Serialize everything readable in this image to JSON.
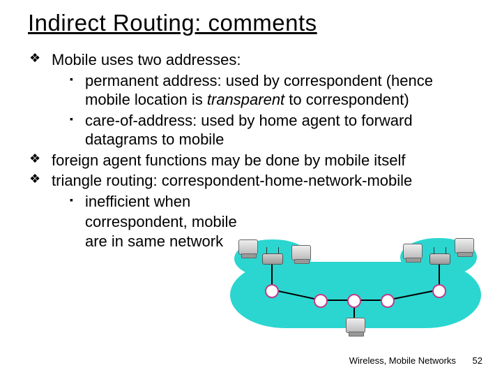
{
  "title": "Indirect Routing: comments",
  "bullets": {
    "b1": "Mobile uses two addresses:",
    "b1a_pre": "permanent address: ",
    "b1a_post": "used by correspondent (hence mobile location is ",
    "b1a_em": "transparent",
    "b1a_tail": " to correspondent)",
    "b1b": "care-of-address: used by home agent to forward datagrams to mobile",
    "b2": "foreign agent functions may be done by mobile itself",
    "b3": "triangle routing: correspondent-home-network-mobile",
    "b3a": "inefficient when",
    "b3_cont1": "correspondent, mobile",
    "b3_cont2": "are in same network"
  },
  "footer": {
    "text": "Wireless, Mobile Networks",
    "page": "52"
  }
}
